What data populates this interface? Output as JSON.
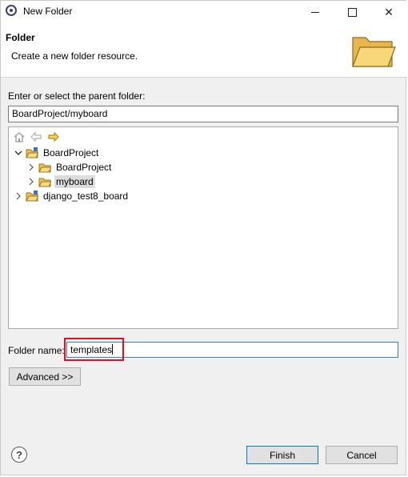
{
  "window": {
    "title": "New Folder",
    "icons": {
      "app": "eclipse-icon",
      "minimize": "minimize-icon",
      "maximize": "maximize-icon",
      "close": "close-icon"
    }
  },
  "banner": {
    "title": "Folder",
    "message": "Create a new folder resource.",
    "icon": "folder-wizard-icon"
  },
  "parent_folder": {
    "label": "Enter or select the parent folder:",
    "value": "BoardProject/myboard"
  },
  "tree": {
    "nav_icons": [
      "home-icon",
      "back-icon",
      "forward-icon"
    ],
    "items": [
      {
        "label": "BoardProject",
        "level": 0,
        "expanded": true,
        "type": "project"
      },
      {
        "label": "BoardProject",
        "level": 1,
        "expanded": false,
        "type": "folder"
      },
      {
        "label": "myboard",
        "level": 1,
        "expanded": false,
        "type": "folder",
        "selected": true
      },
      {
        "label": "django_test8_board",
        "level": 0,
        "expanded": false,
        "type": "project"
      }
    ]
  },
  "folder_name": {
    "label": "Folder name:",
    "value": "templates"
  },
  "buttons": {
    "advanced": "Advanced >>",
    "finish": "Finish",
    "cancel": "Cancel",
    "help_glyph": "?"
  },
  "colors": {
    "highlight_box": "#e0101c",
    "focus_border": "#3c7fb1",
    "folder_yellow": "#f2c44c"
  }
}
